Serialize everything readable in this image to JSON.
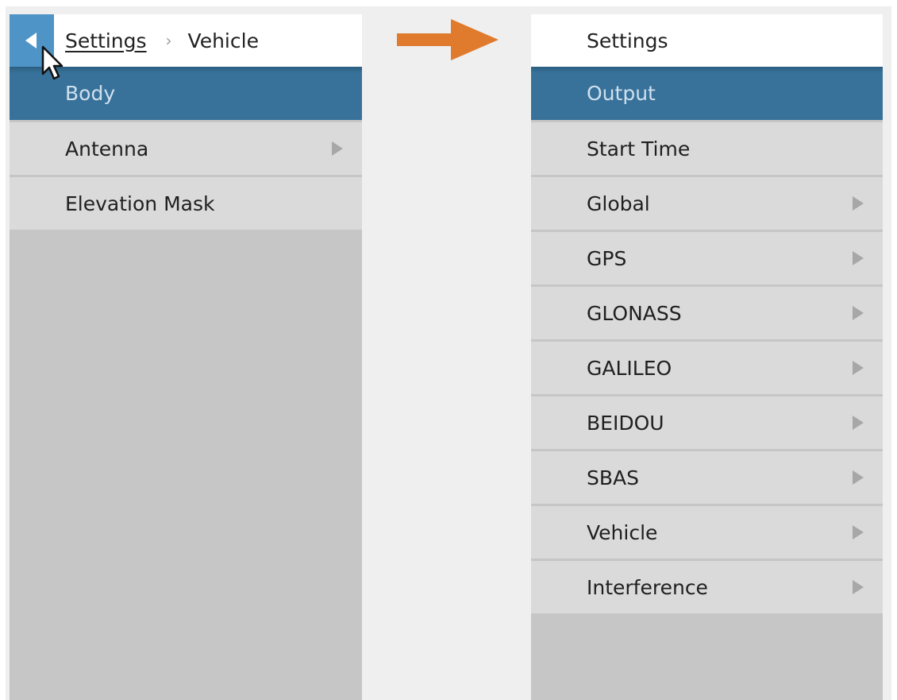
{
  "left": {
    "breadcrumb": {
      "link": "Settings",
      "separator": "›",
      "current": "Vehicle"
    },
    "items": [
      {
        "label": "Body",
        "selected": true,
        "has_submenu": false
      },
      {
        "label": "Antenna",
        "selected": false,
        "has_submenu": true
      },
      {
        "label": "Elevation Mask",
        "selected": false,
        "has_submenu": false
      }
    ]
  },
  "right": {
    "title": "Settings",
    "items": [
      {
        "label": "Output",
        "selected": true,
        "has_submenu": false
      },
      {
        "label": "Start Time",
        "selected": false,
        "has_submenu": false
      },
      {
        "label": "Global",
        "selected": false,
        "has_submenu": true
      },
      {
        "label": "GPS",
        "selected": false,
        "has_submenu": true
      },
      {
        "label": "GLONASS",
        "selected": false,
        "has_submenu": true
      },
      {
        "label": "GALILEO",
        "selected": false,
        "has_submenu": true
      },
      {
        "label": "BEIDOU",
        "selected": false,
        "has_submenu": true
      },
      {
        "label": "SBAS",
        "selected": false,
        "has_submenu": true
      },
      {
        "label": "Vehicle",
        "selected": false,
        "has_submenu": true
      },
      {
        "label": "Interference",
        "selected": false,
        "has_submenu": true
      }
    ]
  },
  "icons": {
    "back": "back-triangle-icon",
    "submenu": "submenu-chevron-icon",
    "cursor": "mouse-pointer-icon",
    "transition": "orange-arrow-icon"
  },
  "colors": {
    "back_button": "#4f94c7",
    "selected_item": "#38729a",
    "item_background": "#dadada",
    "panel_background": "#c6c6c6",
    "arrow": "#e07b2e"
  }
}
